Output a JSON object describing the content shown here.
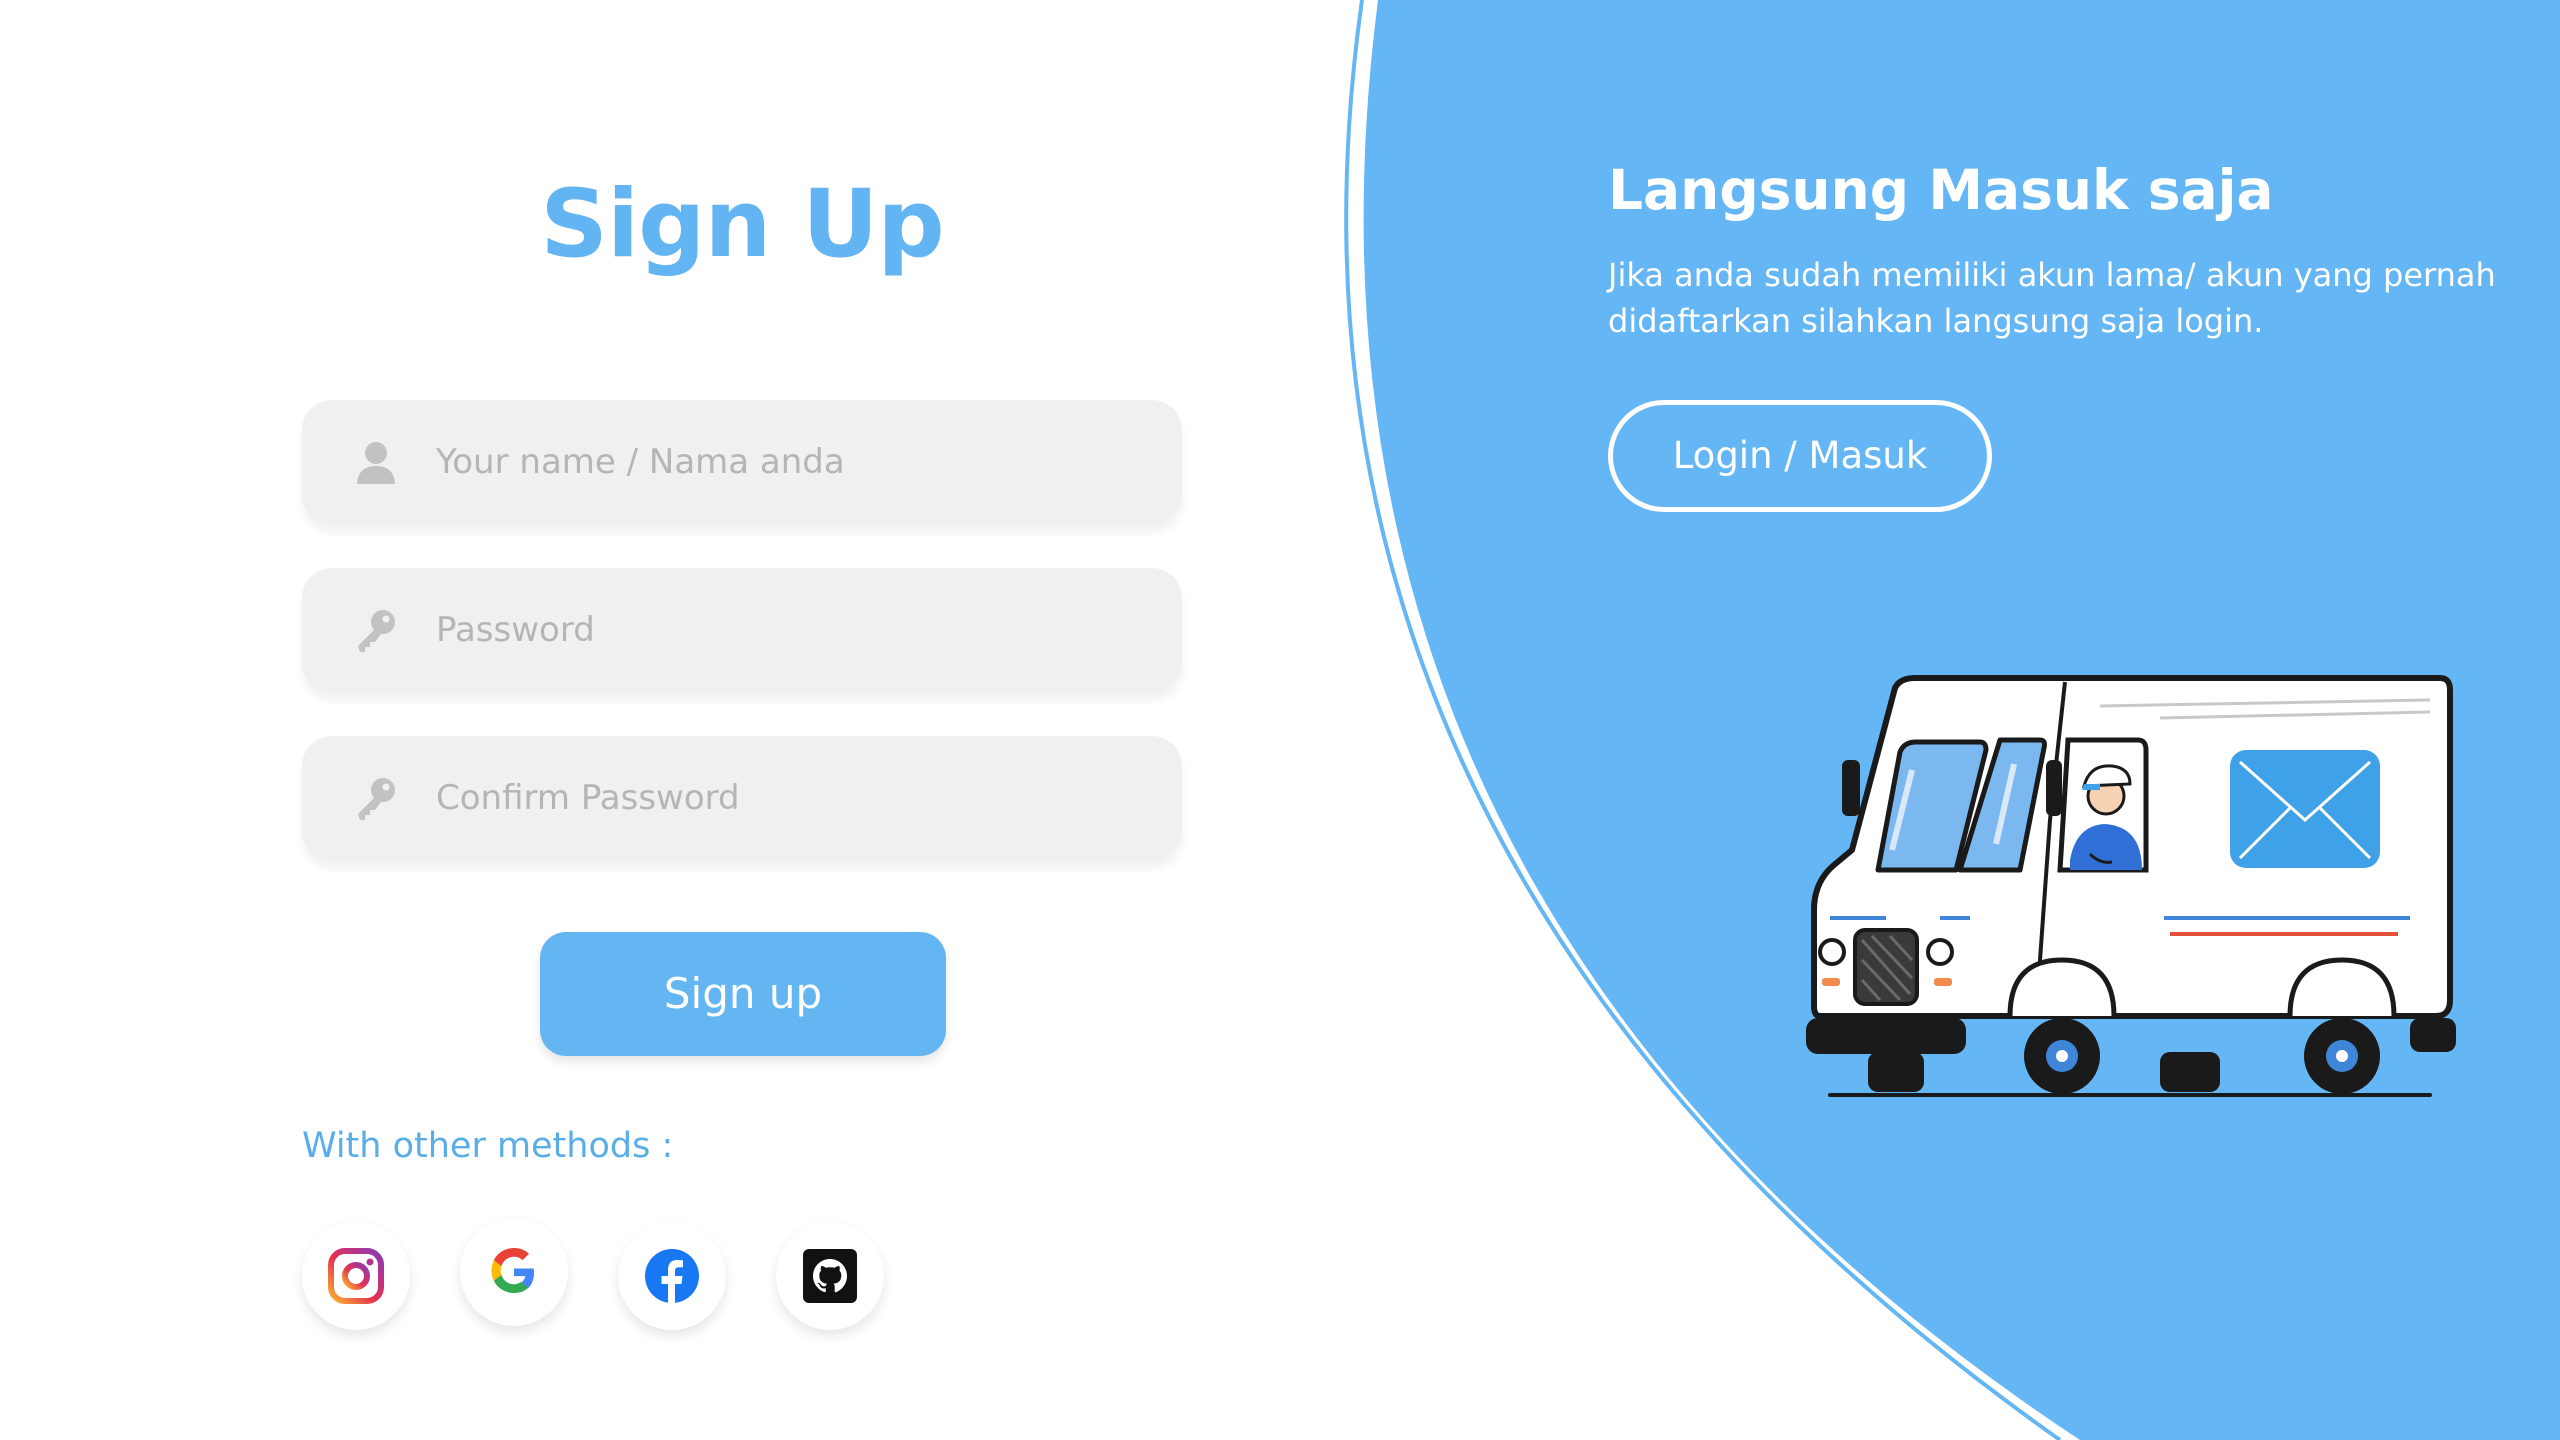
{
  "signup": {
    "title": "Sign Up",
    "name_placeholder": "Your name / Nama anda",
    "password_placeholder": "Password",
    "confirm_placeholder": "Confirm Password",
    "submit_label": "Sign up",
    "other_methods_label": "With other methods :",
    "social": [
      "instagram-icon",
      "google-icon",
      "facebook-icon",
      "github-icon"
    ]
  },
  "panel": {
    "title": "Langsung Masuk saja",
    "description": "Jika anda sudah memiliki akun lama/ akun yang pernah didaftarkan silahkan langsung saja login.",
    "login_label": "Login / Masuk",
    "illustration": "delivery-van"
  },
  "colors": {
    "accent": "#64b6f3",
    "field_bg": "#f0f0f0",
    "placeholder": "#b5b5b5"
  }
}
